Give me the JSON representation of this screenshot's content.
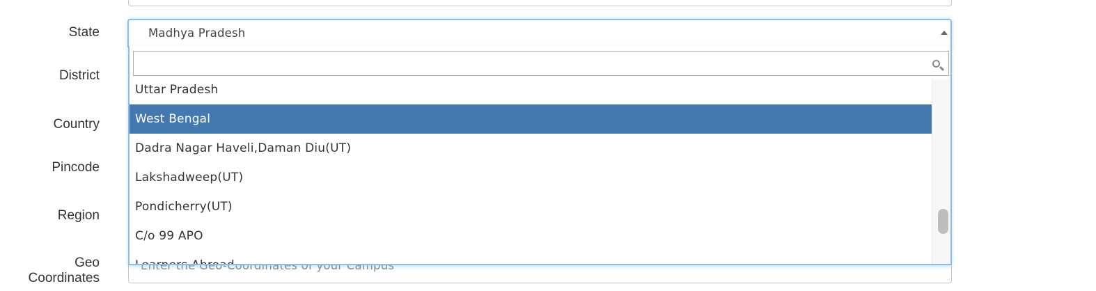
{
  "form": {
    "labels": {
      "state": "State",
      "district": "District",
      "country": "Country",
      "pincode": "Pincode",
      "region": "Region",
      "geo": "Geo Coordinates"
    },
    "state_select": {
      "value": "Madhya Pradesh"
    },
    "geo_input": {
      "placeholder": "Enter the Geo-Coordinates of your Campus"
    }
  },
  "dropdown": {
    "search_value": "",
    "options": [
      "Uttar Pradesh",
      "West Bengal",
      "Dadra Nagar Haveli,Daman Diu(UT)",
      "Lakshadweep(UT)",
      "Pondicherry(UT)",
      "C/o 99 APO",
      "Learners Abroad"
    ],
    "highlighted": "West Bengal",
    "scroll_position": 0.75
  },
  "colors": {
    "highlight": "#4479b0",
    "focus_border": "#8fbbe8"
  },
  "icons": [
    "search-icon",
    "caret-up-icon"
  ]
}
